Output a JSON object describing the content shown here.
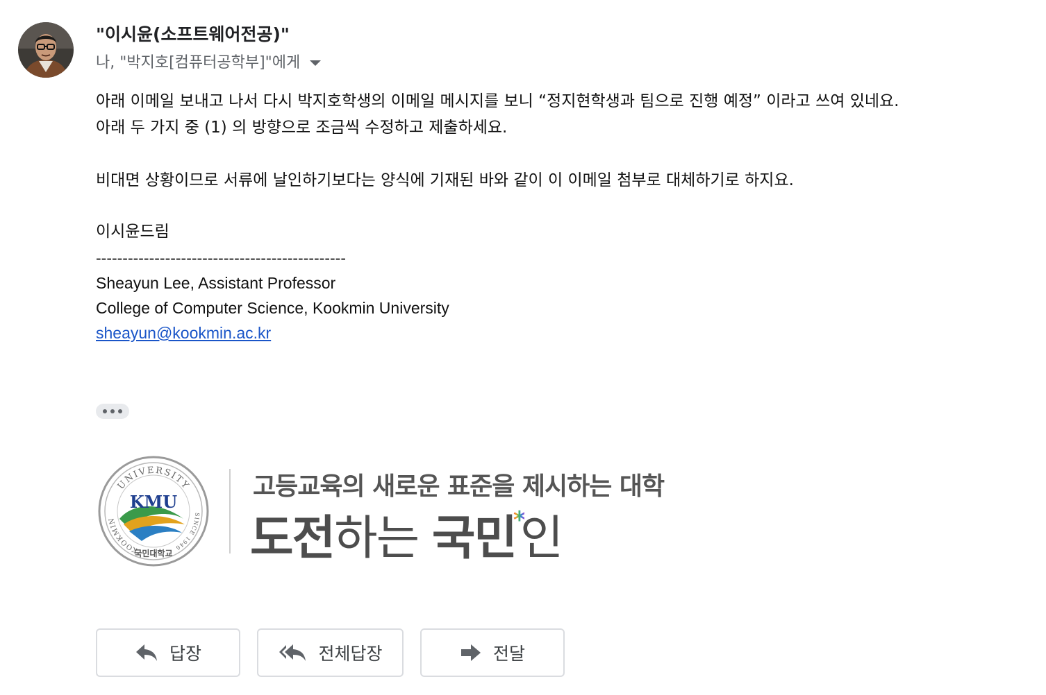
{
  "header": {
    "sender_name": "\"이시윤(소프트웨어전공)\"",
    "recipients": "나, \"박지호[컴퓨터공학부]\"에게"
  },
  "body": {
    "line1": "아래 이메일 보내고 나서 다시 박지호학생의 이메일 메시지를 보니 “정지현학생과 팀으로 진행 예정” 이라고 쓰여 있네요.",
    "line2": "아래 두 가지 중 (1) 의 방향으로 조금씩 수정하고 제출하세요.",
    "line3": "비대면 상황이므로 서류에 날인하기보다는 양식에 기재된 바와 같이 이 이메일 첨부로 대체하기로 하지요.",
    "closing": "이시윤드림"
  },
  "signature": {
    "divider": "-----------------------------------------------",
    "name_title": "Sheayun Lee, Assistant Professor",
    "affiliation": "College of Computer Science, Kookmin University",
    "email": "sheayun@kookmin.ac.kr"
  },
  "logo": {
    "seal_arc_top": "UNIVERSITY",
    "seal_arc_left": "KOOKMIN",
    "seal_since": "SINCE 1946",
    "seal_initials": "KMU",
    "seal_korean": "국민대학교",
    "slogan_small": "고등교육의 새로운 표준을 제시하는 대학",
    "slogan_big_part1": "도전",
    "slogan_big_part2": "하는 ",
    "slogan_big_part3": "국민",
    "slogan_big_star": "*",
    "slogan_big_part4": "인"
  },
  "actions": {
    "reply": "답장",
    "reply_all": "전체답장",
    "forward": "전달"
  },
  "colors": {
    "link": "#1a55c8",
    "secondary_text": "#5f6368",
    "button_border": "#dadce0"
  },
  "icons": {
    "ellipsis": "more-horiz-icon",
    "reply": "reply-arrow-icon",
    "reply_all": "reply-all-arrow-icon",
    "forward": "forward-arrow-icon",
    "recipient_caret": "caret-down-icon"
  }
}
